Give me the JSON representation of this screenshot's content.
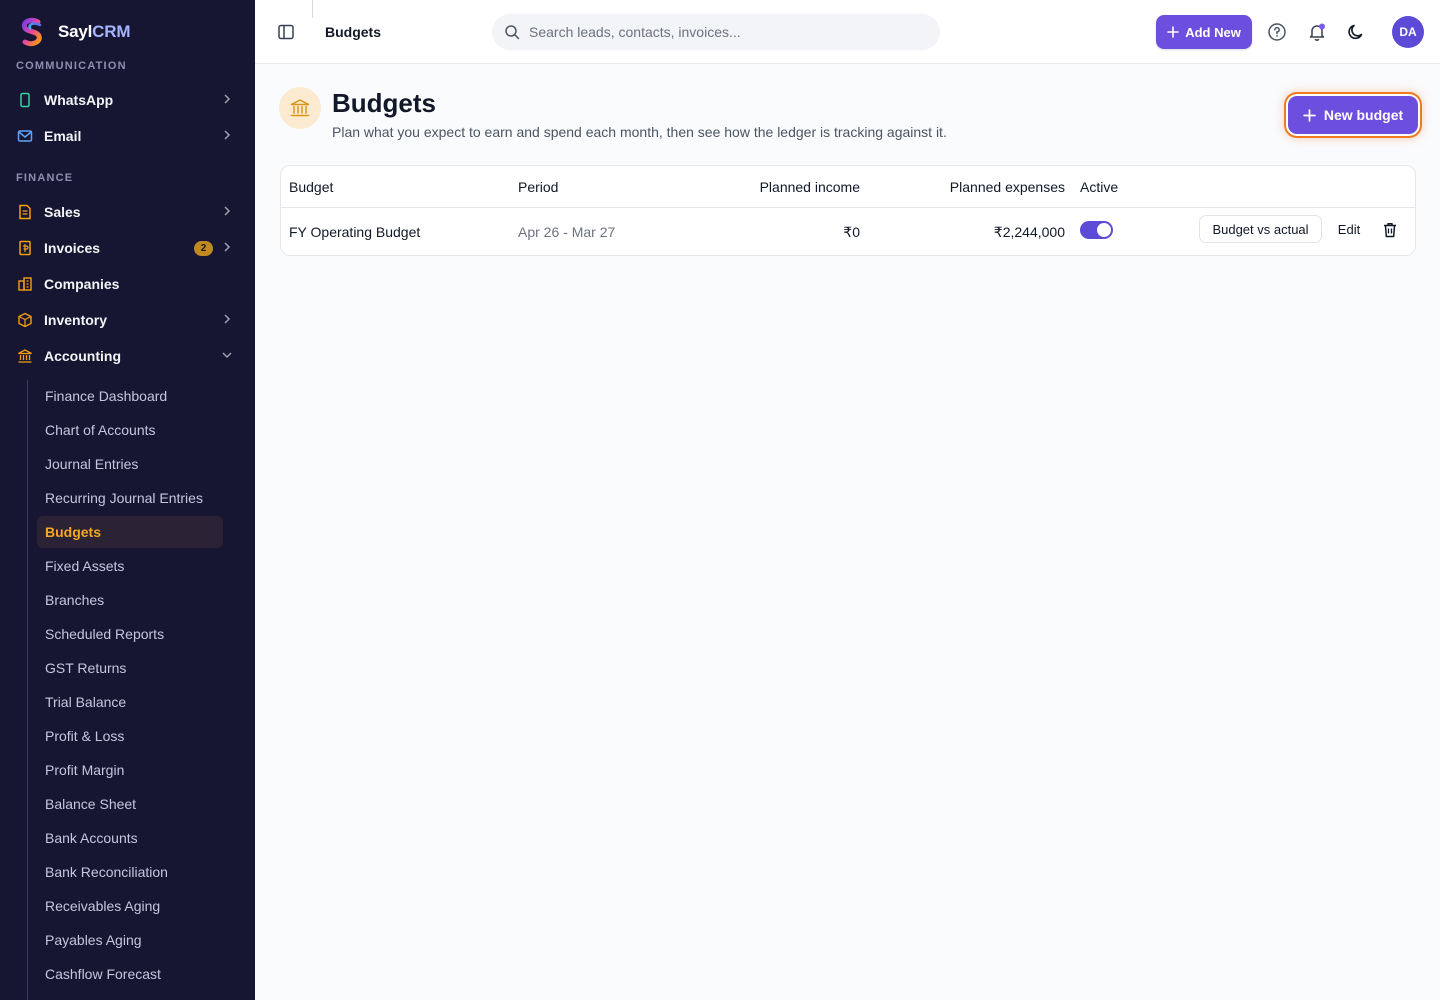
{
  "brand": {
    "name_main": "Sayl",
    "name_accent": "CRM"
  },
  "sidebar": {
    "sections": {
      "communication": "COMMUNICATION",
      "finance": "FINANCE"
    },
    "items": [
      {
        "label": "WhatsApp",
        "icon": "phone-icon"
      },
      {
        "label": "Email",
        "icon": "mail-icon"
      },
      {
        "label": "Sales",
        "icon": "document-icon"
      },
      {
        "label": "Invoices",
        "icon": "receipt-icon",
        "badge": "2"
      },
      {
        "label": "Companies",
        "icon": "building-icon"
      },
      {
        "label": "Inventory",
        "icon": "box-icon"
      },
      {
        "label": "Accounting",
        "icon": "bank-icon"
      }
    ],
    "accounting_sub": [
      "Finance Dashboard",
      "Chart of Accounts",
      "Journal Entries",
      "Recurring Journal Entries",
      "Budgets",
      "Fixed Assets",
      "Branches",
      "Scheduled Reports",
      "GST Returns",
      "Trial Balance",
      "Profit & Loss",
      "Profit Margin",
      "Balance Sheet",
      "Bank Accounts",
      "Bank Reconciliation",
      "Receivables Aging",
      "Payables Aging",
      "Cashflow Forecast"
    ],
    "active_sub": "Budgets"
  },
  "header": {
    "title": "Budgets",
    "search_placeholder": "Search leads, contacts, invoices...",
    "add_new": "Add New",
    "avatar": "DA"
  },
  "page": {
    "title": "Budgets",
    "subtitle": "Plan what you expect to earn and spend each month, then see how the ledger is tracking against it.",
    "new_budget": "New budget"
  },
  "table": {
    "headers": {
      "budget": "Budget",
      "period": "Period",
      "income": "Planned income",
      "expenses": "Planned expenses",
      "active": "Active"
    },
    "rows": [
      {
        "budget": "FY Operating Budget",
        "period": "Apr 26 - Mar 27",
        "income": "₹0",
        "expenses": "₹2,244,000",
        "active": true,
        "bva": "Budget vs actual",
        "edit": "Edit"
      }
    ]
  },
  "colors": {
    "sidebar_bg": "#171632",
    "accent": "#6d4fe0",
    "active_sub": "#f5a623",
    "highlight_ring": "#f07a22"
  }
}
